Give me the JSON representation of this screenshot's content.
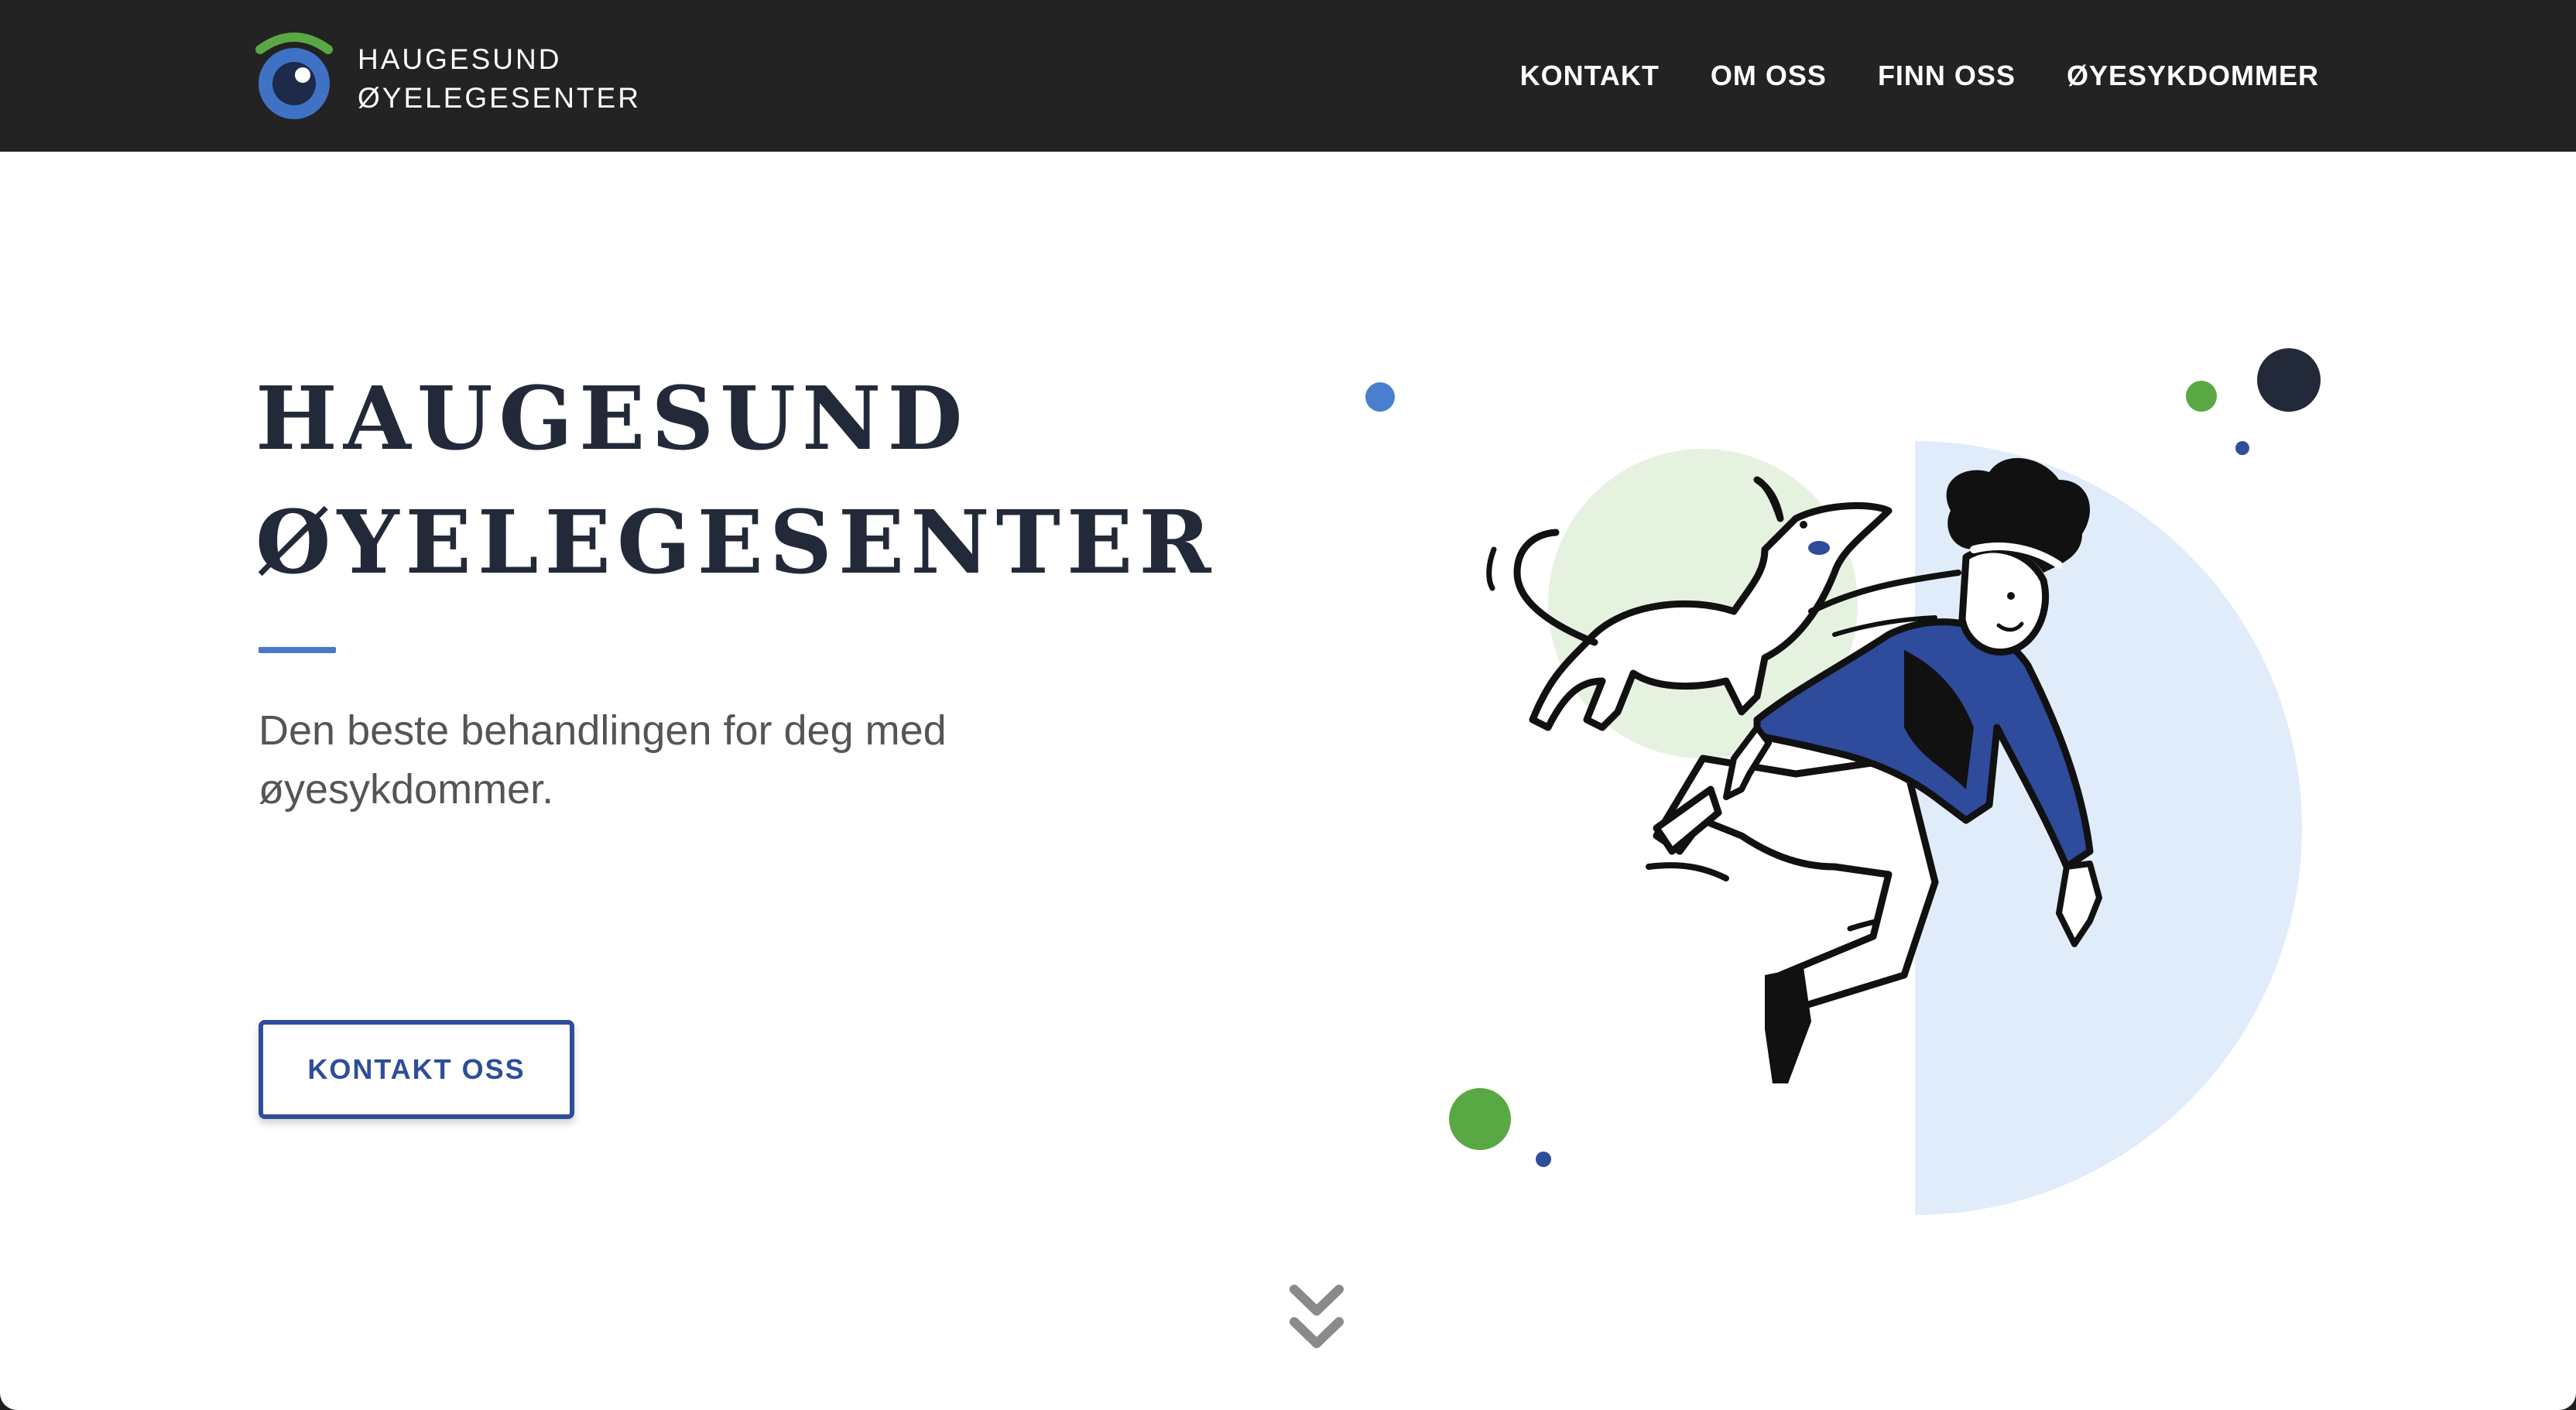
{
  "brand": {
    "name_line1": "HAUGESUND",
    "name_line2": "ØYELEGESENTER",
    "logo_icon": "eye-icon",
    "colors": {
      "arc": "#5aa844",
      "iris": "#3f72c4",
      "pupil": "#1e2a4a"
    }
  },
  "nav": {
    "items": [
      {
        "label": "KONTAKT"
      },
      {
        "label": "OM OSS"
      },
      {
        "label": "FINN OSS"
      },
      {
        "label": "ØYESYKDOMMER"
      }
    ]
  },
  "hero": {
    "title_line1": "HAUGESUND",
    "title_line2": "ØYELEGESENTER",
    "subtitle": "Den beste behandlingen for deg med øyesykdommer.",
    "cta_label": "KONTAKT OSS"
  },
  "illustration": {
    "subject": "person-jumping-with-dog-illustration",
    "colors": {
      "jacket": "#2f4b9c",
      "light_blue": "#e1ecfa",
      "light_green": "#e6f2e0",
      "dot_blue": "#4a7fd0",
      "dot_green": "#5aa844",
      "dot_dark": "#222a3a",
      "dot_navy": "#2e4e9a"
    }
  },
  "scroll_icon": "double-chevron-down-icon",
  "theme": {
    "header_bg": "#232323",
    "heading_color": "#222a3a",
    "accent": "#4a78c6",
    "button_color": "#2e4e9a"
  }
}
